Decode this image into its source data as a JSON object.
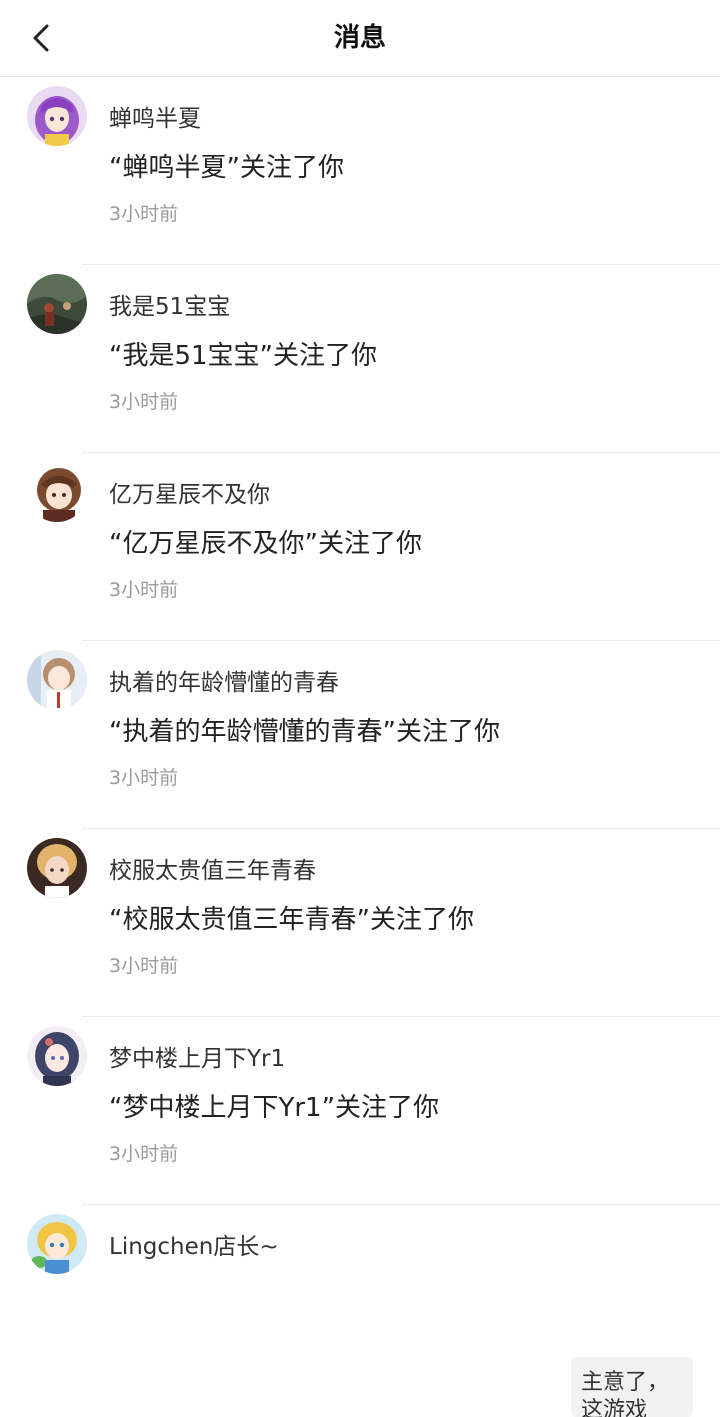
{
  "header": {
    "title": "消息"
  },
  "notifications": [
    {
      "name": "蝉鸣半夏",
      "message": "“蝉鸣半夏”关注了你",
      "time": "3小时前",
      "avatar": "purple-hair-girl-avatar"
    },
    {
      "name": "我是51宝宝",
      "message": "“我是51宝宝”关注了你",
      "time": "3小时前",
      "avatar": "outdoor-photo-avatar"
    },
    {
      "name": "亿万星辰不及你",
      "message": "“亿万星辰不及你”关注了你",
      "time": "3小时前",
      "avatar": "anime-brown-hair-avatar"
    },
    {
      "name": "执着的年龄懵懂的青春",
      "message": "“执着的年龄懵懂的青春”关注了你",
      "time": "3小时前",
      "avatar": "anime-student-avatar"
    },
    {
      "name": "校服太贵值三年青春",
      "message": "“校服太贵值三年青春”关注了你",
      "time": "3小时前",
      "avatar": "blond-boy-avatar"
    },
    {
      "name": "梦中楼上月下Yr1",
      "message": "“梦中楼上月下Yr1”关注了你",
      "time": "3小时前",
      "avatar": "anime-girl-avatar"
    },
    {
      "name": "Lingchen店长~",
      "preview_line1": "主意了，",
      "preview_line2": "这游戏",
      "avatar": "anime-blond-child-avatar"
    }
  ]
}
